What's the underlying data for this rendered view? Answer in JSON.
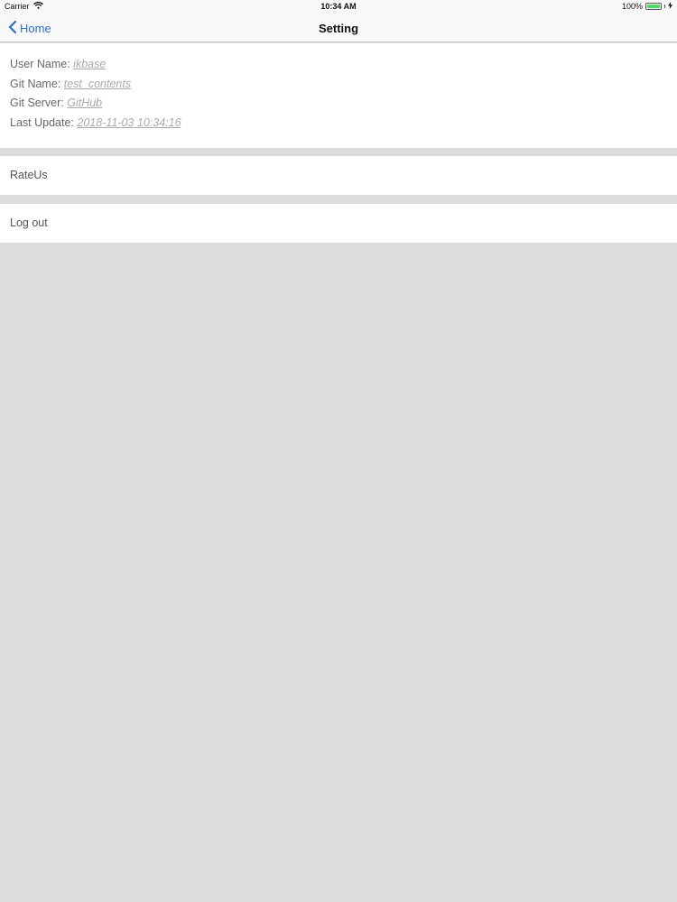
{
  "status_bar": {
    "carrier": "Carrier",
    "time": "10:34 AM",
    "battery": "100%",
    "icons": [
      "wifi-icon",
      "battery-icon",
      "charging-icon"
    ]
  },
  "nav": {
    "back_label": "Home",
    "back_icon": "chevron-left-icon",
    "title": "Setting"
  },
  "info": {
    "user_name_label": "User Name:",
    "user_name_value": "ikbase",
    "git_name_label": "Git Name:",
    "git_name_value": "test_contents",
    "git_server_label": "Git Server:",
    "git_server_value": "GitHub",
    "last_update_label": "Last Update:",
    "last_update_value": "2018-11-03 10:34:16"
  },
  "cells": {
    "rate_us": "RateUs",
    "log_out": "Log out"
  },
  "colors": {
    "accent": "#2c6ecb",
    "background": "#dcdbdd",
    "battery": "#4cd964"
  }
}
